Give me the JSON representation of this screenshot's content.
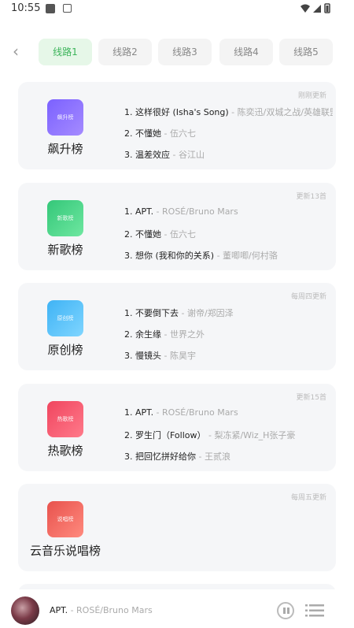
{
  "status_bar": {
    "time": "10:55"
  },
  "tabs": [
    {
      "label": "线路1",
      "active": true
    },
    {
      "label": "线路2",
      "active": false
    },
    {
      "label": "线路3",
      "active": false
    },
    {
      "label": "线路4",
      "active": false
    },
    {
      "label": "线路5",
      "active": false
    }
  ],
  "charts": [
    {
      "name": "飙升榜",
      "cover_text": "飙升榜",
      "cover_colors": [
        "#7b61ff",
        "#a58bff"
      ],
      "update_note": "刚刚更新",
      "songs": [
        {
          "title": "1. 这样很好 (Isha's Song)",
          "artist": " - 陈奕迅/双城之战/英雄联盟"
        },
        {
          "title": "2. 不懂她",
          "artist": " - 伍六七"
        },
        {
          "title": "3. 温差效应",
          "artist": " - 谷江山"
        }
      ]
    },
    {
      "name": "新歌榜",
      "cover_text": "新歌榜",
      "cover_colors": [
        "#34c779",
        "#6ee7a0"
      ],
      "update_note": "更新13首",
      "songs": [
        {
          "title": "1. APT.",
          "artist": " - ROSÉ/Bruno Mars"
        },
        {
          "title": "2. 不懂她",
          "artist": " - 伍六七"
        },
        {
          "title": "3. 想你 (我和你的关系)",
          "artist": " - 董唧唧/何村骆"
        }
      ]
    },
    {
      "name": "原创榜",
      "cover_text": "原创榜",
      "cover_colors": [
        "#3fb3f5",
        "#7fd5ff"
      ],
      "update_note": "每周四更新",
      "songs": [
        {
          "title": "1. 不要倒下去",
          "artist": " - 谢帝/郑因泽"
        },
        {
          "title": "2. 余生缘",
          "artist": " - 世界之外"
        },
        {
          "title": "3. 慢镜头",
          "artist": " - 陈昊宇"
        }
      ]
    },
    {
      "name": "热歌榜",
      "cover_text": "热歌榜",
      "cover_colors": [
        "#f0455f",
        "#ff7a8a"
      ],
      "update_note": "更新15首",
      "songs": [
        {
          "title": "1. APT.",
          "artist": " - ROSÉ/Bruno Mars"
        },
        {
          "title": "2. 罗生门（Follow）",
          "artist": " - 梨冻紧/Wiz_H张子豪"
        },
        {
          "title": "3. 把回忆拼好给你",
          "artist": " - 王贰浪"
        }
      ]
    },
    {
      "name": "云音乐说唱榜",
      "cover_text": "说唱榜",
      "cover_colors": [
        "#e8524d",
        "#ff8a7e"
      ],
      "update_note": "每周五更新",
      "songs": []
    }
  ],
  "player": {
    "title": "APT.",
    "artist": " - ROSÉ/Bruno Mars"
  }
}
